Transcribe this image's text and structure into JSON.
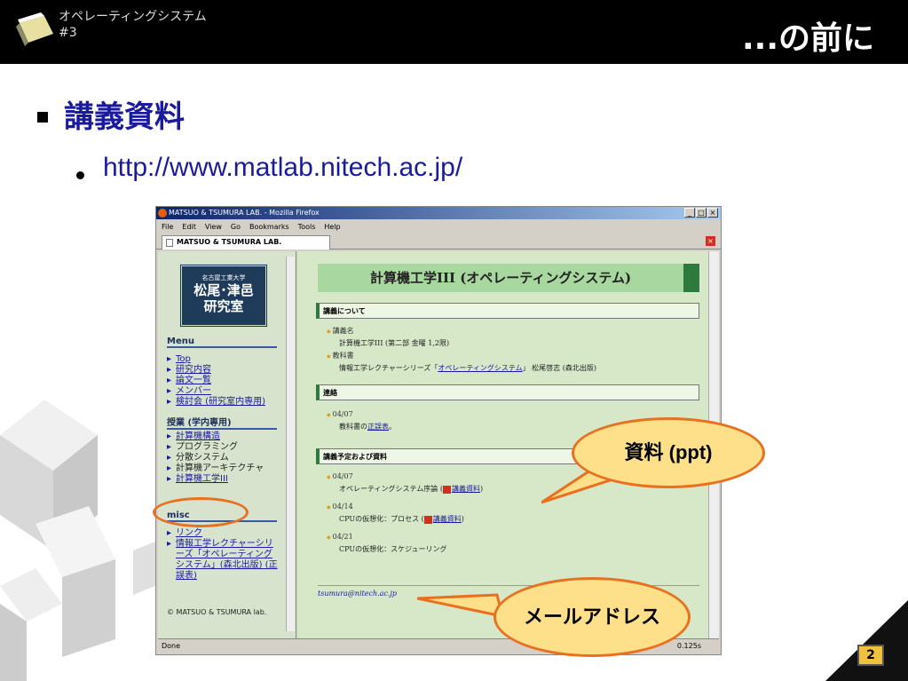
{
  "header": {
    "course": "オペレーティングシステム",
    "lecture": "#3",
    "title": "...の前に"
  },
  "content": {
    "heading": "講義資料",
    "url": "http://www.matlab.nitech.ac.jp/"
  },
  "browser": {
    "window_title": "MATSUO & TSUMURA LAB. - Mozilla Firefox",
    "btn_min": "_",
    "btn_max": "□",
    "btn_close": "×",
    "menu": [
      "File",
      "Edit",
      "View",
      "Go",
      "Bookmarks",
      "Tools",
      "Help"
    ],
    "tab": "MATSUO & TSUMURA LAB.",
    "tab_close": "×",
    "status": "Done",
    "load_time": "0.125s"
  },
  "sidebar": {
    "univ": "名古屋工業大学",
    "lab1": "松尾･津邑",
    "lab2": "研究室",
    "menu_title": "Menu",
    "menu": [
      "Top",
      "研究内容",
      "論文一覧",
      "メンバー",
      "検討会 (研究室内専用)"
    ],
    "class_title": "授業 (学内専用)",
    "classes": [
      "計算機構造",
      "プログラミング",
      "分散システム",
      "計算機アーキテクチャ",
      "計算機工学III"
    ],
    "misc_title": "misc",
    "misc": [
      "リンク",
      "情報工学レクチャーシリーズ「オペレーティングシステム」(森北出版) (正誤表)"
    ],
    "copyright": "© MATSUO & TSUMURA lab."
  },
  "main": {
    "banner": "計算機工学III (オペレーティングシステム)",
    "h_about": "講義について",
    "about_label1": "講義名",
    "about_value1": "計算機工学III (第二部 金曜 1,2限)",
    "about_label2": "教科書",
    "textbook_pre": "情報工学レクチャーシリーズ「",
    "textbook_link": "オペレーティングシステム",
    "textbook_post": "」 松尾啓志 (森北出版)",
    "h_notice": "連絡",
    "notice_date": "04/07",
    "notice_pre": "教科書の",
    "notice_link": "正誤表",
    "notice_post": "。",
    "h_schedule": "講義予定および資料",
    "schedule": [
      {
        "date": "04/07",
        "title": "オペレーティングシステム序論",
        "link": "講義資料"
      },
      {
        "date": "04/14",
        "title": "CPUの仮想化：プロセス",
        "link": "講義資料"
      },
      {
        "date": "04/21",
        "title": "CPUの仮想化：スケジューリング"
      }
    ],
    "email": "tsumura@nitech.ac.jp"
  },
  "callouts": {
    "materials": "資料 (ppt)",
    "email": "メールアドレス"
  },
  "footer": {
    "page": "2"
  }
}
